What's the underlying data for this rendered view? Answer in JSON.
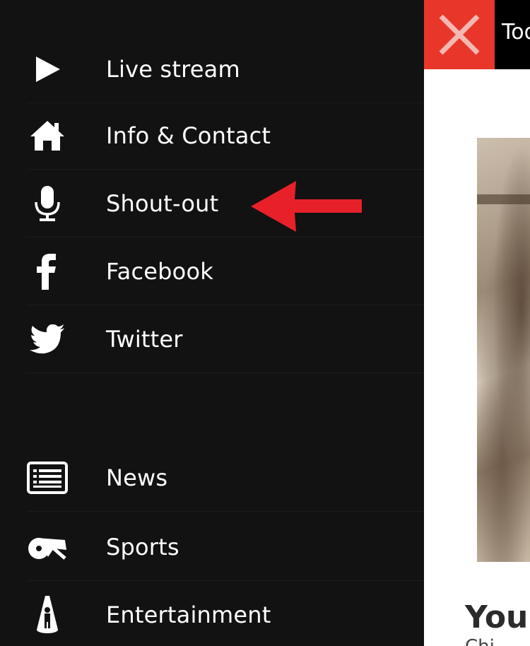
{
  "menu": {
    "items": [
      {
        "label": "Live stream",
        "icon": "play-icon"
      },
      {
        "label": "Info & Contact",
        "icon": "home-icon"
      },
      {
        "label": "Shout-out",
        "icon": "microphone-icon"
      },
      {
        "label": "Facebook",
        "icon": "facebook-icon"
      },
      {
        "label": "Twitter",
        "icon": "twitter-icon"
      },
      {
        "label": "News",
        "icon": "news-icon"
      },
      {
        "label": "Sports",
        "icon": "whistle-icon"
      },
      {
        "label": "Entertainment",
        "icon": "spotlight-performer-icon"
      }
    ]
  },
  "content": {
    "topbar_title": "Tod",
    "article_title": "You'",
    "article_sub": "Chi"
  },
  "colors": {
    "menu_background": "#121212",
    "close_button": "#e8372a",
    "annotation_arrow": "#e8202a"
  }
}
